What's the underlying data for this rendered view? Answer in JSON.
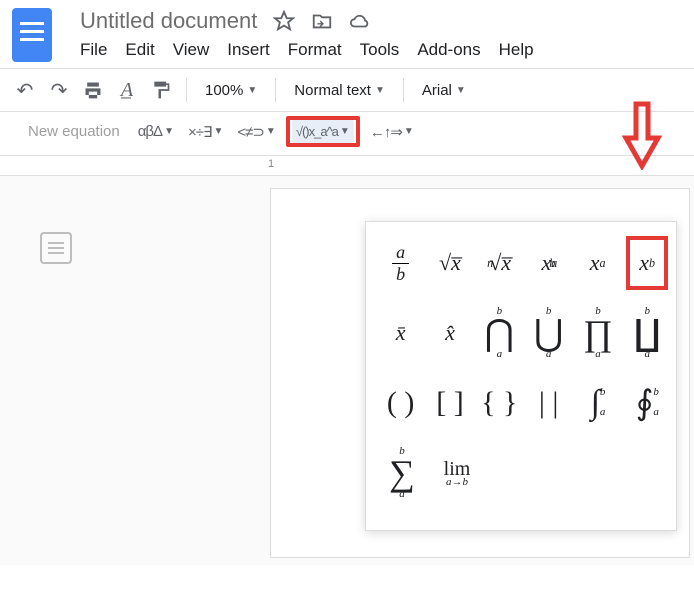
{
  "header": {
    "title": "Untitled document",
    "menu": [
      "File",
      "Edit",
      "View",
      "Insert",
      "Format",
      "Tools",
      "Add-ons",
      "Help"
    ]
  },
  "toolbar": {
    "zoom": "100%",
    "style": "Normal text",
    "font": "Arial"
  },
  "equation_toolbar": {
    "new": "New equation",
    "groups": [
      "αβΔ",
      "×÷∃",
      "<≠⊃",
      "√()x_a^a",
      "←↑⇒"
    ]
  },
  "ruler": {
    "mark1": "1"
  },
  "equation_panel": {
    "rows": [
      [
        {
          "id": "fraction",
          "latex": "a/b"
        },
        {
          "id": "sqrt",
          "latex": "√x"
        },
        {
          "id": "nroot",
          "latex": "ⁿ√x"
        },
        {
          "id": "subsup",
          "latex": "x_a^b"
        },
        {
          "id": "subscript",
          "latex": "x_a"
        },
        {
          "id": "superscript",
          "latex": "x^b",
          "highlight": true
        }
      ],
      [
        {
          "id": "xbar",
          "latex": "x̄"
        },
        {
          "id": "xhat",
          "latex": "x̂"
        },
        {
          "id": "bigcap",
          "latex": "⋂_a^b"
        },
        {
          "id": "bigcup",
          "latex": "⋃_a^b"
        },
        {
          "id": "prod",
          "latex": "∏_a^b"
        },
        {
          "id": "coprod",
          "latex": "∐_a^b"
        }
      ],
      [
        {
          "id": "paren",
          "latex": "()"
        },
        {
          "id": "bracket",
          "latex": "[]"
        },
        {
          "id": "brace",
          "latex": "{}"
        },
        {
          "id": "vbars",
          "latex": "||"
        },
        {
          "id": "int",
          "latex": "∫_a^b"
        },
        {
          "id": "oint",
          "latex": "∮_a^b"
        }
      ],
      [
        {
          "id": "sum",
          "latex": "Σ_a^b"
        },
        {
          "id": "lim",
          "latex": "lim_{a→b}"
        }
      ]
    ]
  }
}
